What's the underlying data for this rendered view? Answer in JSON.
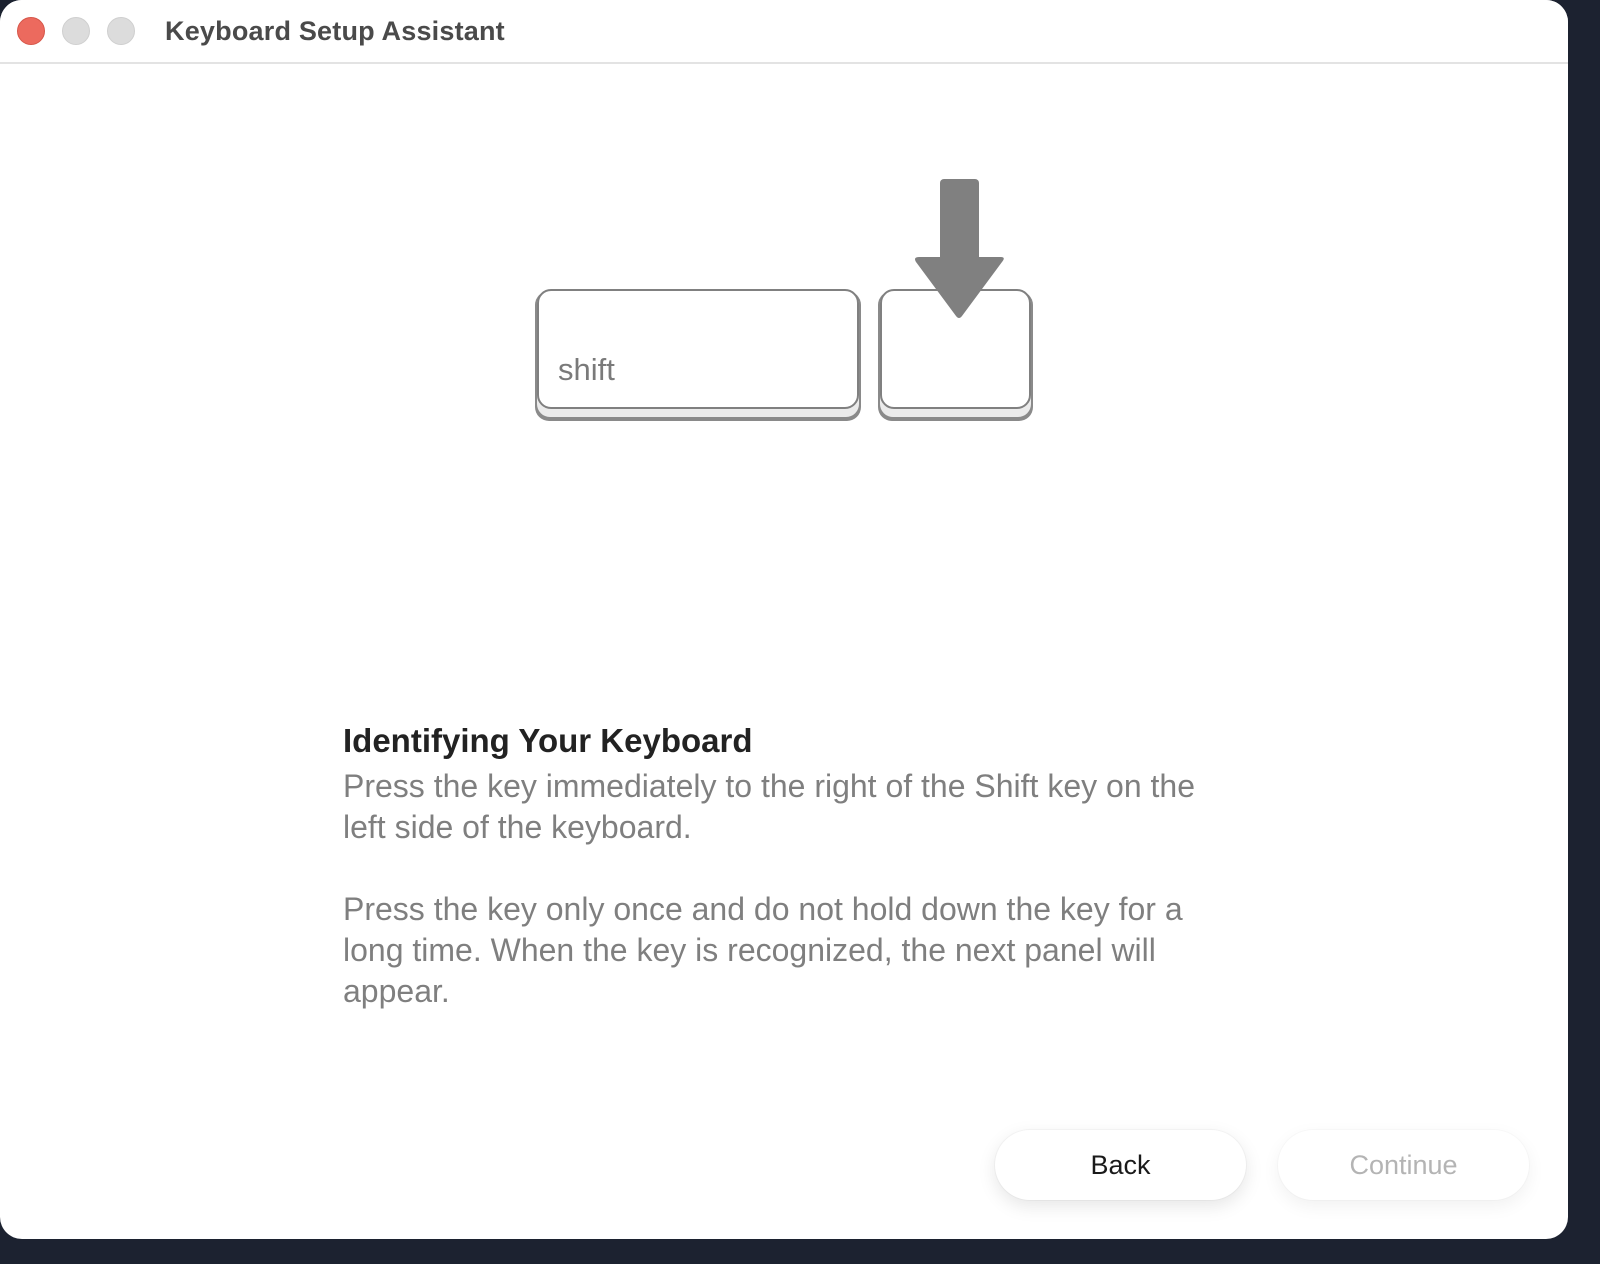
{
  "window": {
    "title": "Keyboard Setup Assistant"
  },
  "illustration": {
    "shift_key_label": "shift",
    "arrow_icon": "down-arrow-icon"
  },
  "instructions": {
    "heading": "Identifying Your Keyboard",
    "paragraph1": "Press the key immediately to the right of the Shift key on the left side of the keyboard.",
    "paragraph2": "Press the key only once and do not hold down the key for a long time. When the key is recognized, the next panel will appear."
  },
  "buttons": {
    "back_label": "Back",
    "continue_label": "Continue",
    "continue_enabled": false
  },
  "colors": {
    "close_button": "#ec6a5e",
    "inactive_traffic": "#dcdcdc",
    "key_outline": "#808080",
    "arrow": "#808080",
    "heading_text": "#222222",
    "body_text": "#7f7f7f",
    "disabled_text": "#b4b4b4"
  }
}
